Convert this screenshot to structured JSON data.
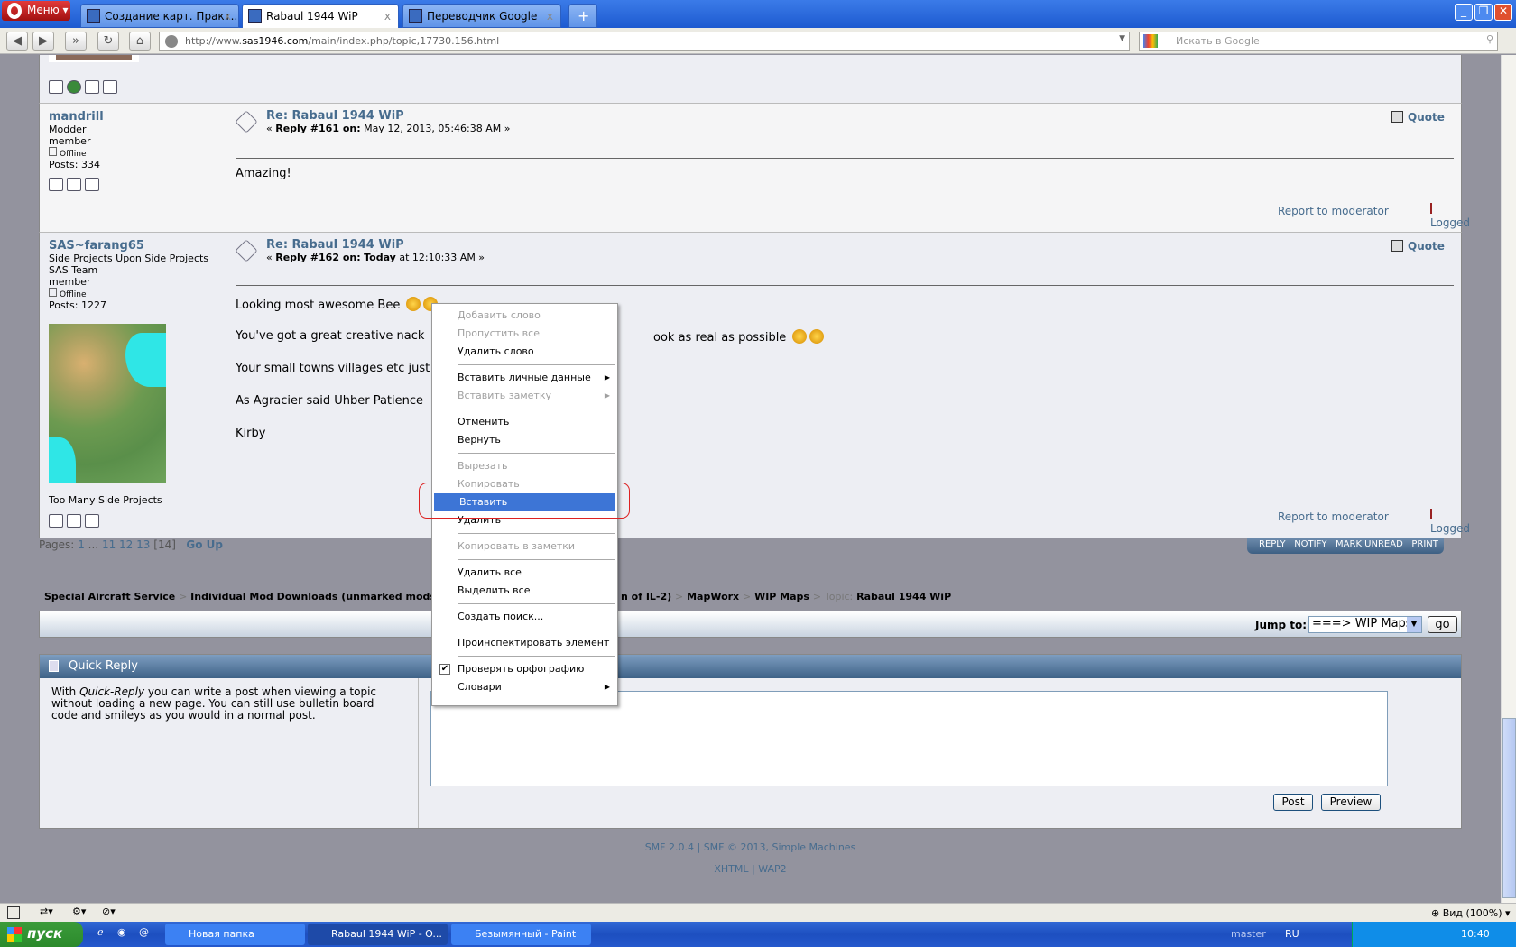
{
  "browser": {
    "menu_label": "Меню",
    "tabs": [
      {
        "title": "Создание карт. Практ..."
      },
      {
        "title": "Rabaul 1944 WiP"
      },
      {
        "title": "Переводчик Google"
      }
    ],
    "url_prefix": "http://www.",
    "url_domain": "sas1946.com",
    "url_path": "/main/index.php/topic,17730.156.html",
    "search_placeholder": "Искать в Google"
  },
  "posts": [
    {
      "author": "mandrill",
      "rank1": "Modder",
      "rank2": "member",
      "status": "Offline",
      "posts": "Posts: 334",
      "title": "Re: Rabaul 1944 WiP",
      "reply_label": "Reply #161 on:",
      "date": "May 12, 2013, 05:46:38 AM",
      "body": [
        "Amazing!"
      ],
      "quote": "Quote",
      "report": "Report to moderator",
      "logged": "Logged"
    },
    {
      "author": "SAS~farang65",
      "rank1": "Side Projects Upon Side Projects",
      "rank2": "SAS Team",
      "rank3": "member",
      "status": "Offline",
      "posts": "Posts: 1227",
      "title": "Re: Rabaul 1944 WiP",
      "reply_label": "Reply #162 on:",
      "date_bold": "Today",
      "date": "at 12:10:33 AM",
      "body": [
        "Looking most awesome Bee",
        "You've got a great creative nack",
        "ook as real as possible",
        "Your small towns villages etc just",
        "As Agracier said Uhber Patience",
        "Kirby"
      ],
      "signature": "Too Many Side Projects",
      "quote": "Quote",
      "report": "Report to moderator",
      "logged": "Logged"
    }
  ],
  "pagination": {
    "label": "Pages:",
    "p1": "1",
    "dots": "...",
    "p11": "11",
    "p12": "12",
    "p13": "13",
    "current": "[14]",
    "go_up": "Go Up"
  },
  "topic_buttons": [
    "REPLY",
    "NOTIFY",
    "MARK UNREAD",
    "PRINT"
  ],
  "linktree": [
    "Special Aircraft Service",
    "Individual Mod Downloads (unmarked mods migh",
    "n of IL-2)",
    "MapWorx",
    "WIP Maps"
  ],
  "linktree_topic_label": "Topic:",
  "linktree_topic": "Rabaul 1944 WiP",
  "jump": {
    "label": "Jump to:",
    "selected": "===> WIP Maps",
    "go": "go"
  },
  "quick_reply": {
    "title": "Quick Reply",
    "desc_pre": "With ",
    "desc_em": "Quick-Reply",
    "desc_post": " you can write a post when viewing a topic without loading a new page. You can still use bulletin board code and smileys as you would in a normal post.",
    "post": "Post",
    "preview": "Preview"
  },
  "footer": {
    "smf": "SMF 2.0.4",
    "copy": "SMF © 2013, Simple Machines",
    "xhtml": "XHTML",
    "wap2": "WAP2"
  },
  "context_menu": [
    {
      "label": "Добавить слово",
      "disabled": true
    },
    {
      "label": "Пропустить все",
      "disabled": true
    },
    {
      "label": "Удалить слово"
    },
    {
      "sep": true
    },
    {
      "label": "Вставить личные данные",
      "sub": true
    },
    {
      "label": "Вставить заметку",
      "disabled": true,
      "sub": true
    },
    {
      "sep": true
    },
    {
      "label": "Отменить"
    },
    {
      "label": "Вернуть"
    },
    {
      "sep": true
    },
    {
      "label": "Вырезать",
      "disabled": true
    },
    {
      "label": "Копировать",
      "disabled": true
    },
    {
      "label": "Вставить",
      "highlighted": true
    },
    {
      "label": "Удалить"
    },
    {
      "sep": true
    },
    {
      "label": "Копировать в заметки",
      "disabled": true
    },
    {
      "sep": true
    },
    {
      "label": "Удалить все"
    },
    {
      "label": "Выделить все"
    },
    {
      "sep": true
    },
    {
      "label": "Создать поиск..."
    },
    {
      "sep": true
    },
    {
      "label": "Проинспектировать элемент"
    },
    {
      "sep": true
    },
    {
      "label": "Проверять орфографию",
      "checked": true
    },
    {
      "label": "Словари",
      "sub": true
    }
  ],
  "statusbar": {
    "zoom": "Вид (100%)"
  },
  "taskbar": {
    "start": "пуск",
    "items": [
      "Новая папка",
      "Rabaul 1944 WiP - O...",
      "Безымянный - Paint"
    ],
    "toolbar": "master",
    "lang": "RU",
    "clock": "10:40"
  },
  "colors": {
    "link": "#476c8e",
    "highlight": "#3d75d6",
    "annotation": "#d22"
  }
}
